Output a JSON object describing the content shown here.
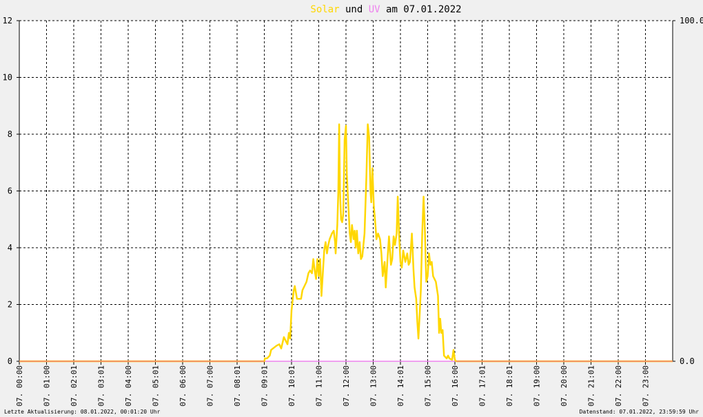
{
  "title": {
    "part_solar": "Solar",
    "part_und": "und",
    "part_uv": "UV",
    "part_am": "am 07.01.2022",
    "color_solar": "#ffd700",
    "color_uv": "#ee82ee",
    "color_text": "#000000"
  },
  "footer": {
    "left": "Letzte Aktualisierung: 08.01.2022, 00:01:20 Uhr",
    "right": "Datenstand: 07.01.2022, 23:59:59 Uhr"
  },
  "chart_data": {
    "type": "line",
    "grid": true,
    "background": "#ffffff",
    "y_left": {
      "min": 0,
      "max": 12,
      "ticks": [
        "0",
        "2",
        "4",
        "6",
        "8",
        "10",
        "12"
      ]
    },
    "y_right": {
      "min": 0,
      "max": 100,
      "ticks": [
        "0.0",
        "100.0"
      ]
    },
    "x_range_hours": [
      0,
      24
    ],
    "x_ticks": [
      {
        "hour": 0,
        "label": "07. 00:00"
      },
      {
        "hour": 1,
        "label": "07. 01:00"
      },
      {
        "hour": 2,
        "label": "07. 02:01"
      },
      {
        "hour": 3,
        "label": "07. 03:01"
      },
      {
        "hour": 4,
        "label": "07. 04:00"
      },
      {
        "hour": 5,
        "label": "07. 05:01"
      },
      {
        "hour": 6,
        "label": "07. 06:00"
      },
      {
        "hour": 7,
        "label": "07. 07:00"
      },
      {
        "hour": 8,
        "label": "07. 08:01"
      },
      {
        "hour": 9,
        "label": "07. 09:01"
      },
      {
        "hour": 10,
        "label": "07. 10:01"
      },
      {
        "hour": 11,
        "label": "07. 11:00"
      },
      {
        "hour": 12,
        "label": "07. 12:00"
      },
      {
        "hour": 13,
        "label": "07. 13:00"
      },
      {
        "hour": 14,
        "label": "07. 14:01"
      },
      {
        "hour": 15,
        "label": "07. 15:00"
      },
      {
        "hour": 16,
        "label": "07. 16:00"
      },
      {
        "hour": 17,
        "label": "07. 17:01"
      },
      {
        "hour": 18,
        "label": "07. 18:01"
      },
      {
        "hour": 19,
        "label": "07. 19:00"
      },
      {
        "hour": 20,
        "label": "07. 20:00"
      },
      {
        "hour": 21,
        "label": "07. 21:01"
      },
      {
        "hour": 22,
        "label": "07. 22:00"
      },
      {
        "hour": 23,
        "label": "07. 23:00"
      }
    ],
    "series": [
      {
        "name": "Solar",
        "axis": "left",
        "color": "#ffd700",
        "points": [
          [
            0.0,
            0
          ],
          [
            9.0,
            0
          ],
          [
            9.02,
            0.1
          ],
          [
            9.1,
            0.1
          ],
          [
            9.2,
            0.2
          ],
          [
            9.25,
            0.4
          ],
          [
            9.45,
            0.55
          ],
          [
            9.55,
            0.6
          ],
          [
            9.62,
            0.45
          ],
          [
            9.72,
            0.85
          ],
          [
            9.85,
            0.6
          ],
          [
            9.9,
            1.0
          ],
          [
            9.95,
            0.8
          ],
          [
            10.0,
            1.8
          ],
          [
            10.08,
            2.5
          ],
          [
            10.12,
            2.65
          ],
          [
            10.2,
            2.2
          ],
          [
            10.35,
            2.2
          ],
          [
            10.4,
            2.5
          ],
          [
            10.55,
            2.8
          ],
          [
            10.62,
            3.1
          ],
          [
            10.68,
            3.2
          ],
          [
            10.75,
            3.1
          ],
          [
            10.8,
            3.6
          ],
          [
            10.85,
            3.2
          ],
          [
            10.9,
            2.9
          ],
          [
            10.95,
            3.6
          ],
          [
            11.0,
            3.0
          ],
          [
            11.05,
            3.6
          ],
          [
            11.1,
            2.3
          ],
          [
            11.2,
            3.9
          ],
          [
            11.25,
            4.2
          ],
          [
            11.3,
            3.8
          ],
          [
            11.35,
            4.1
          ],
          [
            11.4,
            4.3
          ],
          [
            11.48,
            4.5
          ],
          [
            11.55,
            4.6
          ],
          [
            11.6,
            4.2
          ],
          [
            11.62,
            3.8
          ],
          [
            11.68,
            4.8
          ],
          [
            11.72,
            6.0
          ],
          [
            11.75,
            8.35
          ],
          [
            11.78,
            6.0
          ],
          [
            11.82,
            5.0
          ],
          [
            11.86,
            4.9
          ],
          [
            11.9,
            5.2
          ],
          [
            11.95,
            7.8
          ],
          [
            12.0,
            8.3
          ],
          [
            12.03,
            6.6
          ],
          [
            12.08,
            5.6
          ],
          [
            12.14,
            4.5
          ],
          [
            12.18,
            4.2
          ],
          [
            12.22,
            4.8
          ],
          [
            12.28,
            4.3
          ],
          [
            12.32,
            4.6
          ],
          [
            12.36,
            4.0
          ],
          [
            12.4,
            4.6
          ],
          [
            12.45,
            3.8
          ],
          [
            12.5,
            4.2
          ],
          [
            12.55,
            3.6
          ],
          [
            12.6,
            3.7
          ],
          [
            12.68,
            4.5
          ],
          [
            12.75,
            6.5
          ],
          [
            12.8,
            8.35
          ],
          [
            12.85,
            7.9
          ],
          [
            12.9,
            6.0
          ],
          [
            12.93,
            5.6
          ],
          [
            12.97,
            6.8
          ],
          [
            13.02,
            5.5
          ],
          [
            13.08,
            4.8
          ],
          [
            13.12,
            4.3
          ],
          [
            13.18,
            4.5
          ],
          [
            13.25,
            4.3
          ],
          [
            13.3,
            3.8
          ],
          [
            13.35,
            3.0
          ],
          [
            13.42,
            3.5
          ],
          [
            13.46,
            2.6
          ],
          [
            13.52,
            3.5
          ],
          [
            13.58,
            4.4
          ],
          [
            13.65,
            3.4
          ],
          [
            13.7,
            3.6
          ],
          [
            13.75,
            4.4
          ],
          [
            13.8,
            4.1
          ],
          [
            13.86,
            4.5
          ],
          [
            13.9,
            5.8
          ],
          [
            13.95,
            4.5
          ],
          [
            14.0,
            3.5
          ],
          [
            14.05,
            3.3
          ],
          [
            14.1,
            3.9
          ],
          [
            14.18,
            3.5
          ],
          [
            14.25,
            3.8
          ],
          [
            14.3,
            3.4
          ],
          [
            14.35,
            3.5
          ],
          [
            14.42,
            4.5
          ],
          [
            14.48,
            3.2
          ],
          [
            14.52,
            2.6
          ],
          [
            14.58,
            2.2
          ],
          [
            14.62,
            1.4
          ],
          [
            14.66,
            0.8
          ],
          [
            14.7,
            1.5
          ],
          [
            14.75,
            2.5
          ],
          [
            14.8,
            4.5
          ],
          [
            14.85,
            5.8
          ],
          [
            14.9,
            4.5
          ],
          [
            14.95,
            2.8
          ],
          [
            15.0,
            3.0
          ],
          [
            15.05,
            3.8
          ],
          [
            15.1,
            3.4
          ],
          [
            15.15,
            3.5
          ],
          [
            15.2,
            3.0
          ],
          [
            15.3,
            2.8
          ],
          [
            15.38,
            2.3
          ],
          [
            15.42,
            1.0
          ],
          [
            15.46,
            1.5
          ],
          [
            15.5,
            1.0
          ],
          [
            15.55,
            1.1
          ],
          [
            15.6,
            0.2
          ],
          [
            15.7,
            0.1
          ],
          [
            15.75,
            0.2
          ],
          [
            15.8,
            0.1
          ],
          [
            15.9,
            0.05
          ],
          [
            15.95,
            0.4
          ],
          [
            16.0,
            0.05
          ],
          [
            16.05,
            0
          ],
          [
            24.0,
            0
          ]
        ]
      },
      {
        "name": "UV",
        "axis": "right",
        "color": "#ee82ee",
        "points": [
          [
            0.0,
            0
          ],
          [
            9.2,
            0
          ],
          [
            16.0,
            0
          ],
          [
            24.0,
            0
          ]
        ]
      }
    ]
  }
}
